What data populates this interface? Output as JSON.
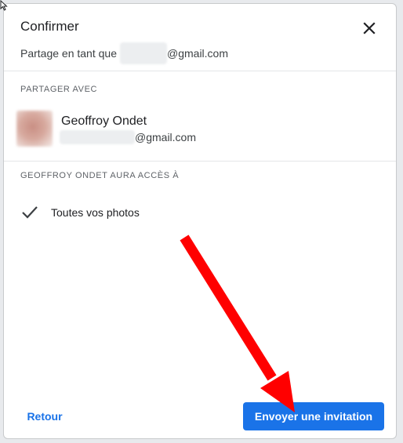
{
  "dialog": {
    "title": "Confirmer",
    "subtitle_prefix": "Partage en tant que",
    "subtitle_suffix": "@gmail.com",
    "close_icon": "close-icon"
  },
  "share_with": {
    "label": "PARTAGER AVEC",
    "contact_name": "Geoffroy Ondet",
    "contact_email_suffix": "@gmail.com"
  },
  "access": {
    "label": "GEOFFROY ONDET AURA ACCÈS À",
    "items": [
      {
        "icon": "check-icon",
        "label": "Toutes vos photos"
      }
    ]
  },
  "actions": {
    "back_label": "Retour",
    "send_label": "Envoyer une invitation"
  },
  "colors": {
    "accent": "#1a73e8",
    "annotation_arrow": "#ff0000"
  }
}
